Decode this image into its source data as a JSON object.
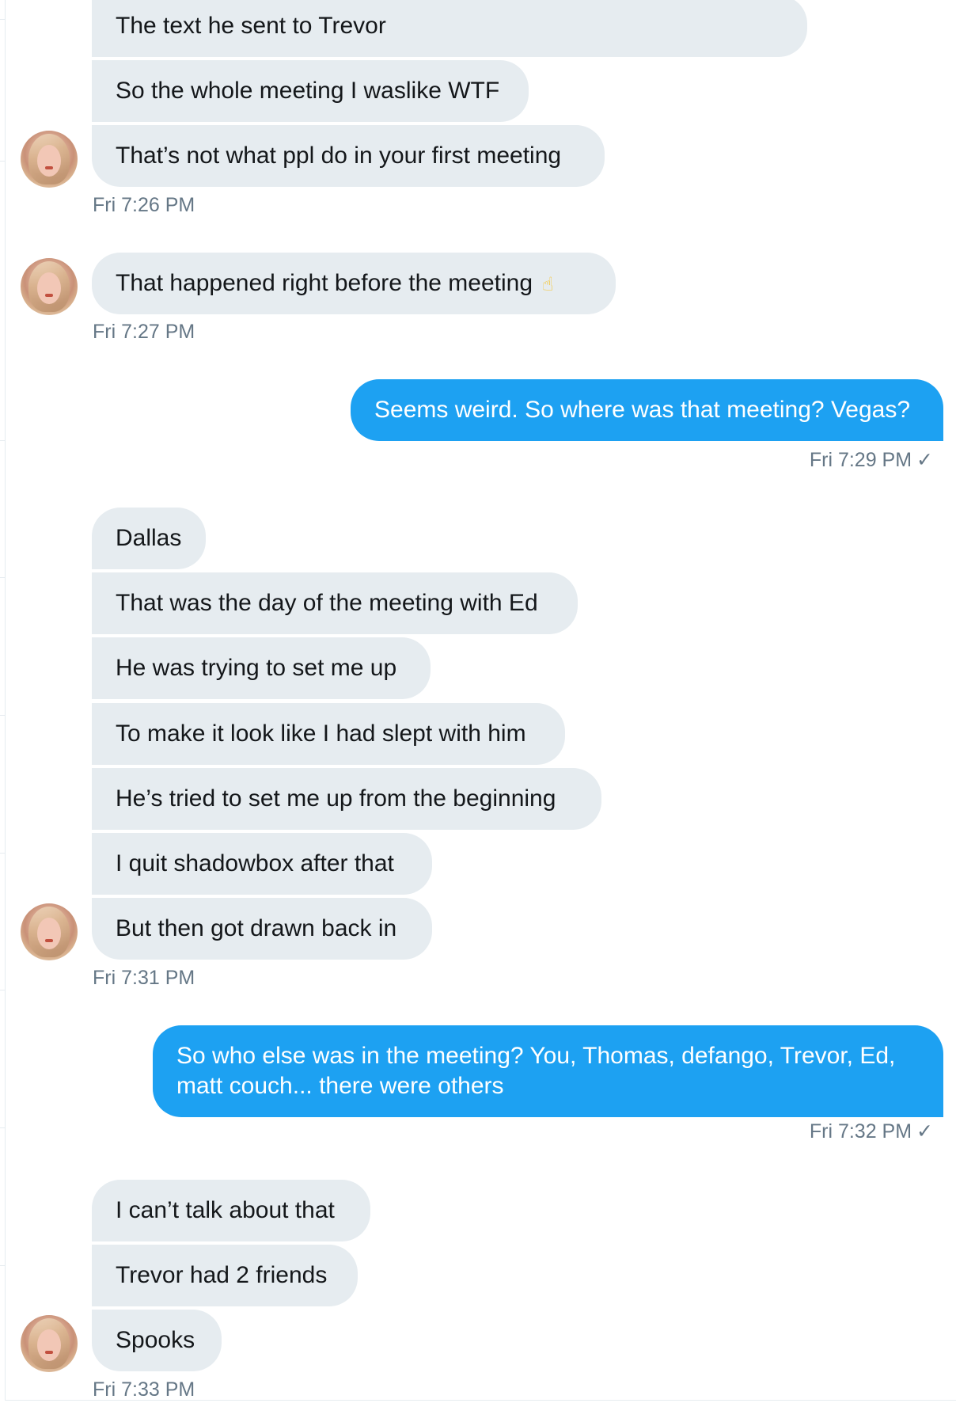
{
  "thread": [
    {
      "type": "incoming",
      "messages": [
        "The text he sent to Trevor",
        "So the whole meeting I waslike WTF",
        "That’s not what ppl do in your first meeting"
      ],
      "timestamp": "Fri 7:26 PM"
    },
    {
      "type": "incoming",
      "messages": [
        "That happened right before the meeting"
      ],
      "timestamp": "Fri 7:27 PM",
      "emoji_icon": "pointing-up-icon"
    },
    {
      "type": "outgoing",
      "messages": [
        "Seems weird. So where was that meeting? Vegas?"
      ],
      "timestamp": "Fri 7:29 PM",
      "checkmark": "✓"
    },
    {
      "type": "incoming",
      "messages": [
        "Dallas",
        "That was the day of the meeting with Ed",
        "He was trying to set me up",
        "To make it look like I had slept with him",
        "He’s tried to set me up from the beginning",
        "I quit shadowbox after that",
        "But then got drawn back in"
      ],
      "timestamp": "Fri 7:31 PM"
    },
    {
      "type": "outgoing",
      "messages": [
        "So who else was in the meeting? You, Thomas, defango, Trevor, Ed,",
        "matt couch... there were others"
      ],
      "timestamp": "Fri 7:32 PM",
      "checkmark": "✓"
    },
    {
      "type": "incoming",
      "messages": [
        "I can’t talk about that",
        "Trevor had 2 friends",
        "Spooks"
      ],
      "timestamp": "Fri 7:33 PM"
    }
  ],
  "colors": {
    "incoming_bubble": "#e6ecf0",
    "outgoing_bubble": "#1da1f2",
    "timestamp": "#657786",
    "text_dark": "#14171a",
    "text_light": "#ffffff"
  }
}
